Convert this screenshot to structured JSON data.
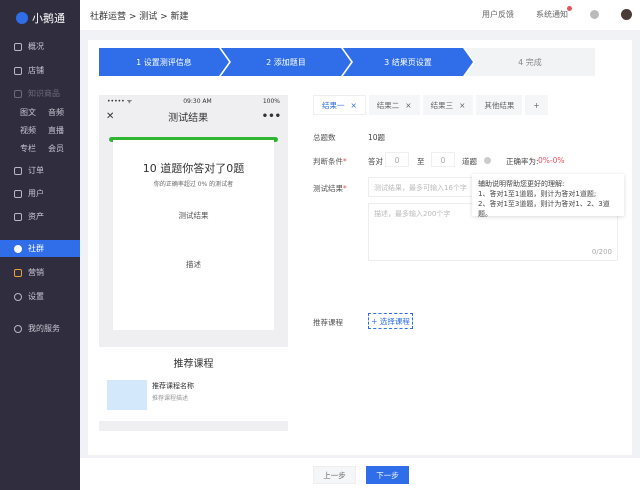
{
  "app": {
    "name": "小鹅通"
  },
  "sidebar": {
    "items": [
      {
        "label": "概况",
        "icon": "dashboard-icon"
      },
      {
        "label": "店铺",
        "icon": "store-icon"
      },
      {
        "label": "知识商品",
        "icon": "grid-icon"
      },
      {
        "label": "订单",
        "icon": "order-icon"
      },
      {
        "label": "用户",
        "icon": "user-icon"
      },
      {
        "label": "资产",
        "icon": "asset-icon"
      },
      {
        "label": "社群",
        "icon": "community-icon"
      },
      {
        "label": "营销",
        "icon": "marketing-icon"
      },
      {
        "label": "设置",
        "icon": "gear-icon"
      },
      {
        "label": "我的服务",
        "icon": "heart-icon"
      }
    ],
    "sub": [
      [
        "图文",
        "音频"
      ],
      [
        "视频",
        "直播"
      ],
      [
        "专栏",
        "会员"
      ]
    ]
  },
  "header": {
    "breadcrumb": "社群运营 > 测试 > 新建",
    "feedback": "用户反馈",
    "notice": "系统通知"
  },
  "steps": [
    "1  设置测评信息",
    "2  添加题目",
    "3  结果页设置",
    "4  完成"
  ],
  "phone": {
    "carrier": "••••• ᯤ",
    "time": "09:30 AM",
    "battery": "100%",
    "title": "测试结果",
    "headline": "10 道题你答对了0题",
    "subline": "你的正确率超过 0% 的测试者",
    "result": "测试结果",
    "desc": "描述",
    "rec_title": "推荐课程",
    "rec_name": "推荐课程名称",
    "rec_desc": "推荐课程描述"
  },
  "form": {
    "tabs": [
      "结果一",
      "结果二",
      "结果三",
      "其他结果",
      "+"
    ],
    "total_label": "总题数",
    "total_value": "10题",
    "cond_label": "判断条件",
    "cond_prefix": "答对",
    "cond_from": "0",
    "cond_to_label": "至",
    "cond_to": "0",
    "cond_suffix": "道题",
    "rate_label": "正确率为:",
    "rate_value": "0%-0%",
    "result_label": "测试结果",
    "result_placeholder": "测试结果，最多可输入16个字",
    "desc_placeholder": "描述，最多输入200个字",
    "counter": "0/200",
    "tip": [
      "辅助说明帮助您更好的理解:",
      "1、答对1至1道题，则计为答对1道题;",
      "2、答对1至3道题，则计为答对1、2、3道题。"
    ],
    "course_label": "推荐课程",
    "course_button": "+ 选择课程"
  },
  "footer": {
    "prev": "上一步",
    "next": "下一步"
  },
  "colors": {
    "primary": "#2f6ee8",
    "sidebar": "#302d3f",
    "green": "#2fb52f",
    "rate": "#e8505b"
  }
}
